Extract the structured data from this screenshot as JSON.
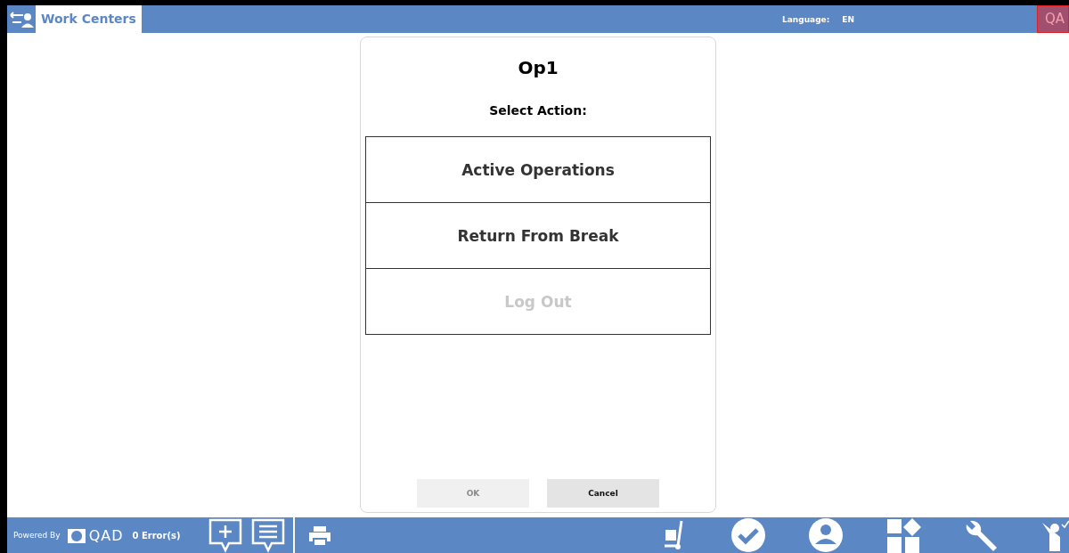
{
  "header": {
    "tab": {
      "label": "Work Centers",
      "selected": true
    },
    "language_label": "Language:",
    "language": "EN",
    "logo": "QA"
  },
  "dialog": {
    "title": "Op1",
    "prompt": "Select Action:",
    "actions": [
      {
        "label": "Active Operations",
        "disabled": false
      },
      {
        "label": "Return From Break",
        "disabled": false
      },
      {
        "label": "Log Out",
        "disabled": true
      }
    ],
    "buttons": [
      {
        "label": "OK",
        "disabled": true
      },
      {
        "label": "Cancel",
        "disabled": false
      }
    ]
  },
  "footer": {
    "powered_by": "Powered By",
    "brand": "QAD",
    "errors": "0 Error(s)"
  }
}
